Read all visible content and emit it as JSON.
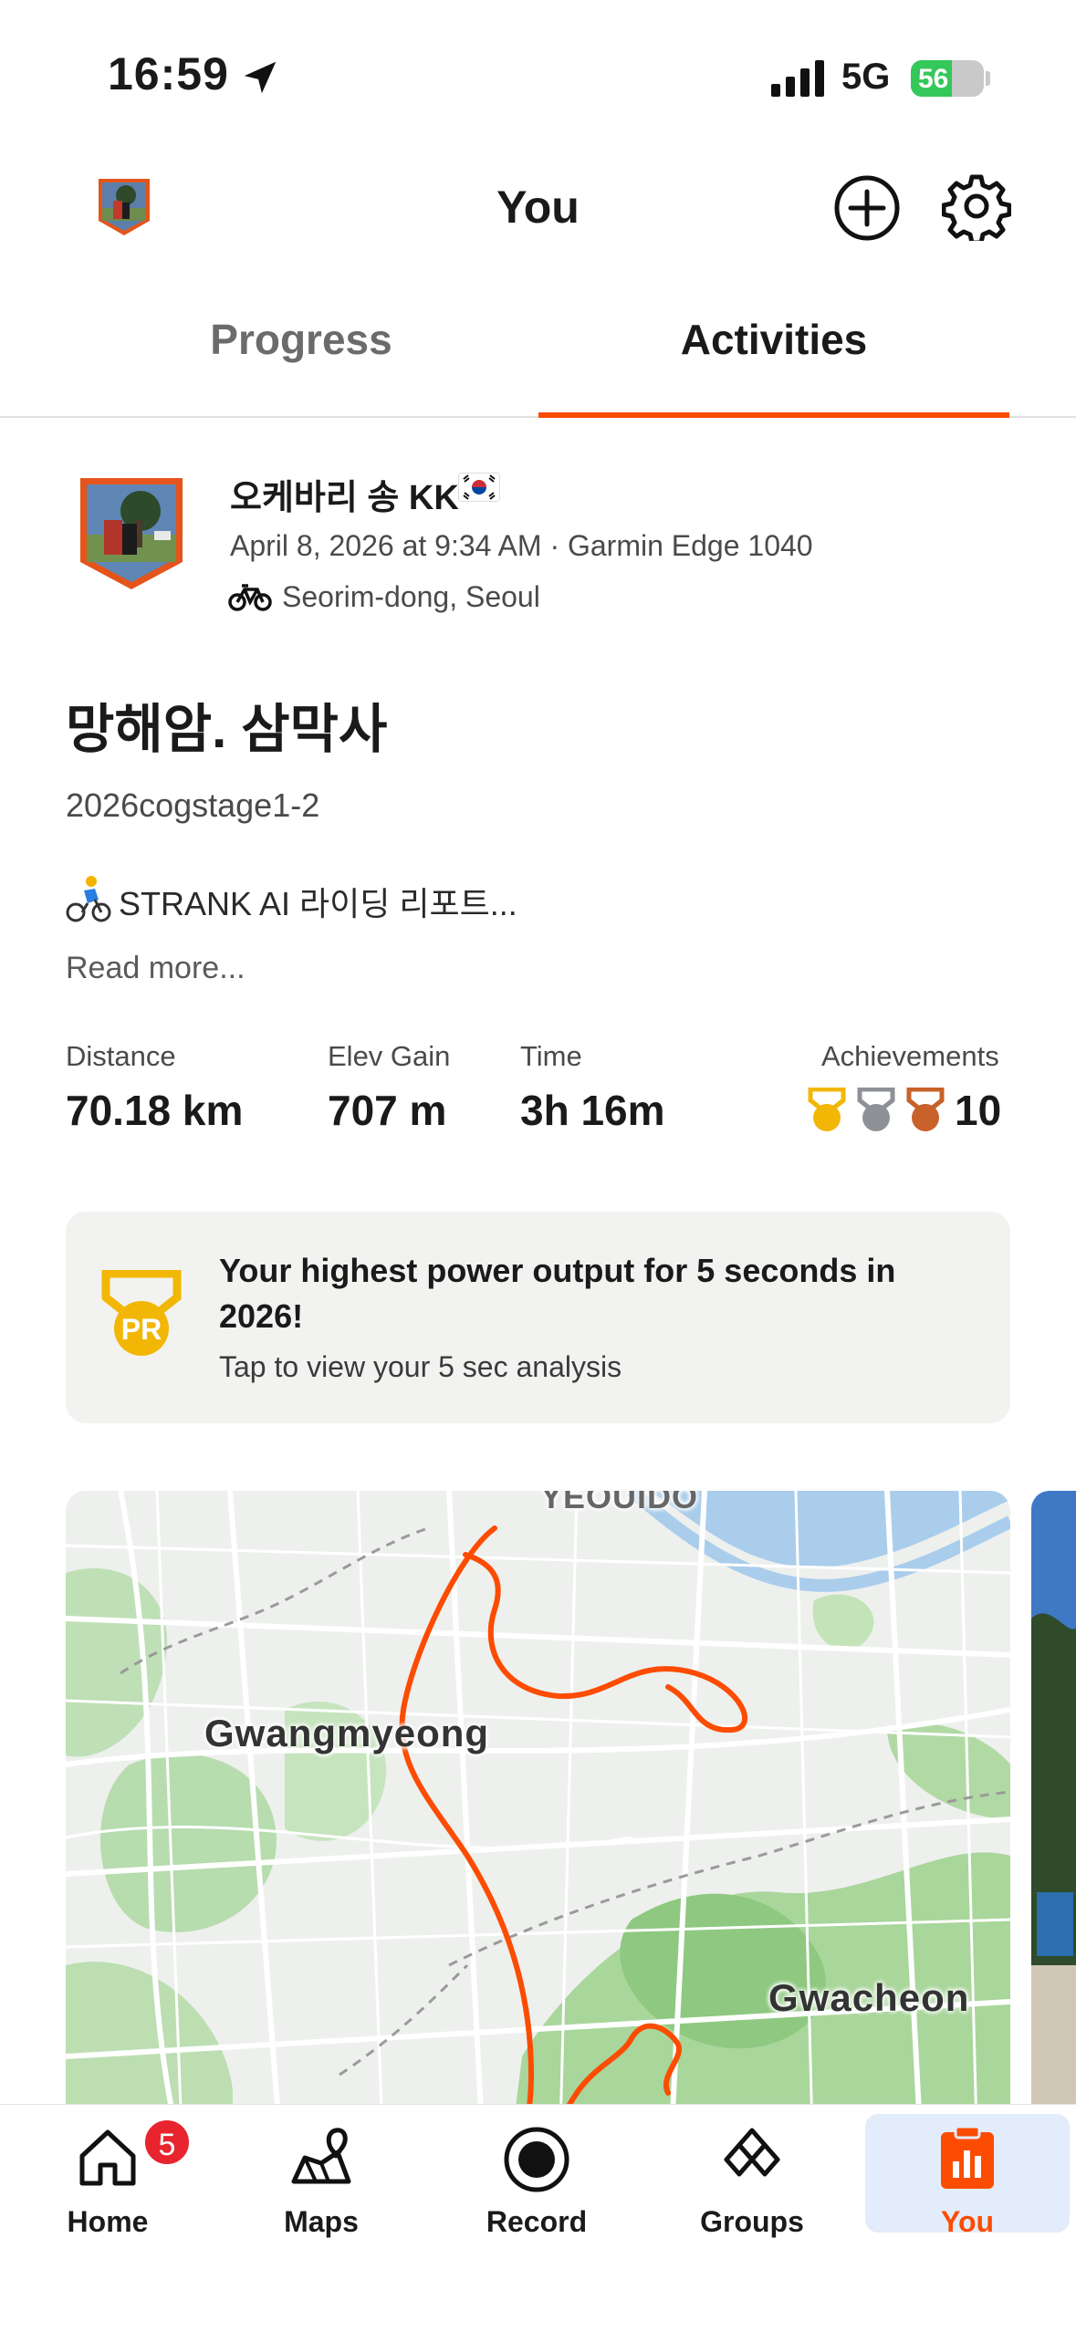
{
  "status_bar": {
    "time": "16:59",
    "network": "5G",
    "battery": "56",
    "battery_level": 0.56
  },
  "header": {
    "title": "You"
  },
  "tabs": [
    {
      "label": "Progress",
      "active": false
    },
    {
      "label": "Activities",
      "active": true
    }
  ],
  "activity": {
    "athlete_name": "오케바리 송 KK",
    "meta": "April 8, 2026 at 9:34 AM · Garmin Edge 1040",
    "location": "Seorim-dong, Seoul",
    "title": "망해암. 삼막사",
    "tag": "2026cogstage1-2",
    "description": "STRANK AI 라이딩 리포트...",
    "read_more": "Read more..."
  },
  "stats": {
    "distance": {
      "label": "Distance",
      "value": "70.18 km"
    },
    "elev_gain": {
      "label": "Elev Gain",
      "value": "707 m"
    },
    "time": {
      "label": "Time",
      "value": "3h 16m"
    },
    "achievements": {
      "label": "Achievements",
      "value": "10"
    }
  },
  "pr_card": {
    "badge_text": "PR",
    "title": "Your highest power output for 5 seconds in 2026!",
    "subtitle": "Tap to view your 5 sec analysis"
  },
  "map": {
    "labels": [
      "YEOUIDO",
      "Gwangmyeong",
      "Gwacheon"
    ],
    "route_color": "#fc4c02"
  },
  "tab_bar": {
    "items": [
      {
        "label": "Home",
        "icon": "home-icon",
        "badge": "5"
      },
      {
        "label": "Maps",
        "icon": "maps-icon"
      },
      {
        "label": "Record",
        "icon": "record-icon"
      },
      {
        "label": "Groups",
        "icon": "groups-icon"
      },
      {
        "label": "You",
        "icon": "you-icon",
        "active": true
      }
    ]
  },
  "colors": {
    "accent": "#fc4c02",
    "gold": "#f2b705",
    "silver": "#8e9296",
    "bronze": "#c8612a"
  }
}
